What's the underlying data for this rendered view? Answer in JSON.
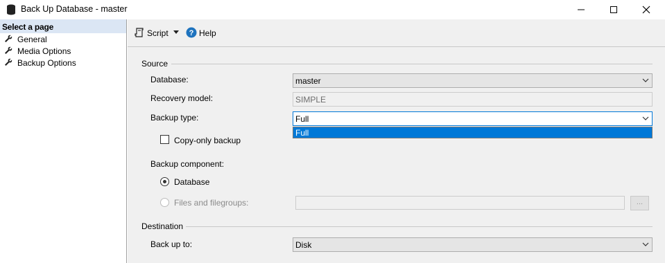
{
  "window": {
    "title": "Back Up Database - master",
    "icon": "database-icon"
  },
  "sidebar": {
    "header": "Select a page",
    "items": [
      {
        "label": "General",
        "icon": "wrench-icon"
      },
      {
        "label": "Media Options",
        "icon": "wrench-icon"
      },
      {
        "label": "Backup Options",
        "icon": "wrench-icon"
      }
    ]
  },
  "toolbar": {
    "script_label": "Script",
    "help_label": "Help"
  },
  "source": {
    "group_label": "Source",
    "database_label": "Database:",
    "database_value": "master",
    "recovery_label": "Recovery model:",
    "recovery_value": "SIMPLE",
    "backup_type_label": "Backup type:",
    "backup_type_value": "Full",
    "backup_type_options": [
      "Full"
    ],
    "copy_only_label": "Copy-only backup",
    "copy_only_checked": false,
    "component_label": "Backup component:",
    "component_database_label": "Database",
    "component_files_label": "Files and filegroups:",
    "browse_label": "..."
  },
  "destination": {
    "group_label": "Destination",
    "back_up_to_label": "Back up to:",
    "back_up_to_value": "Disk"
  },
  "colors": {
    "accent": "#0078d7",
    "sidebar_header_bg": "#dbe6f4",
    "panel_bg": "#f0f0f0"
  }
}
